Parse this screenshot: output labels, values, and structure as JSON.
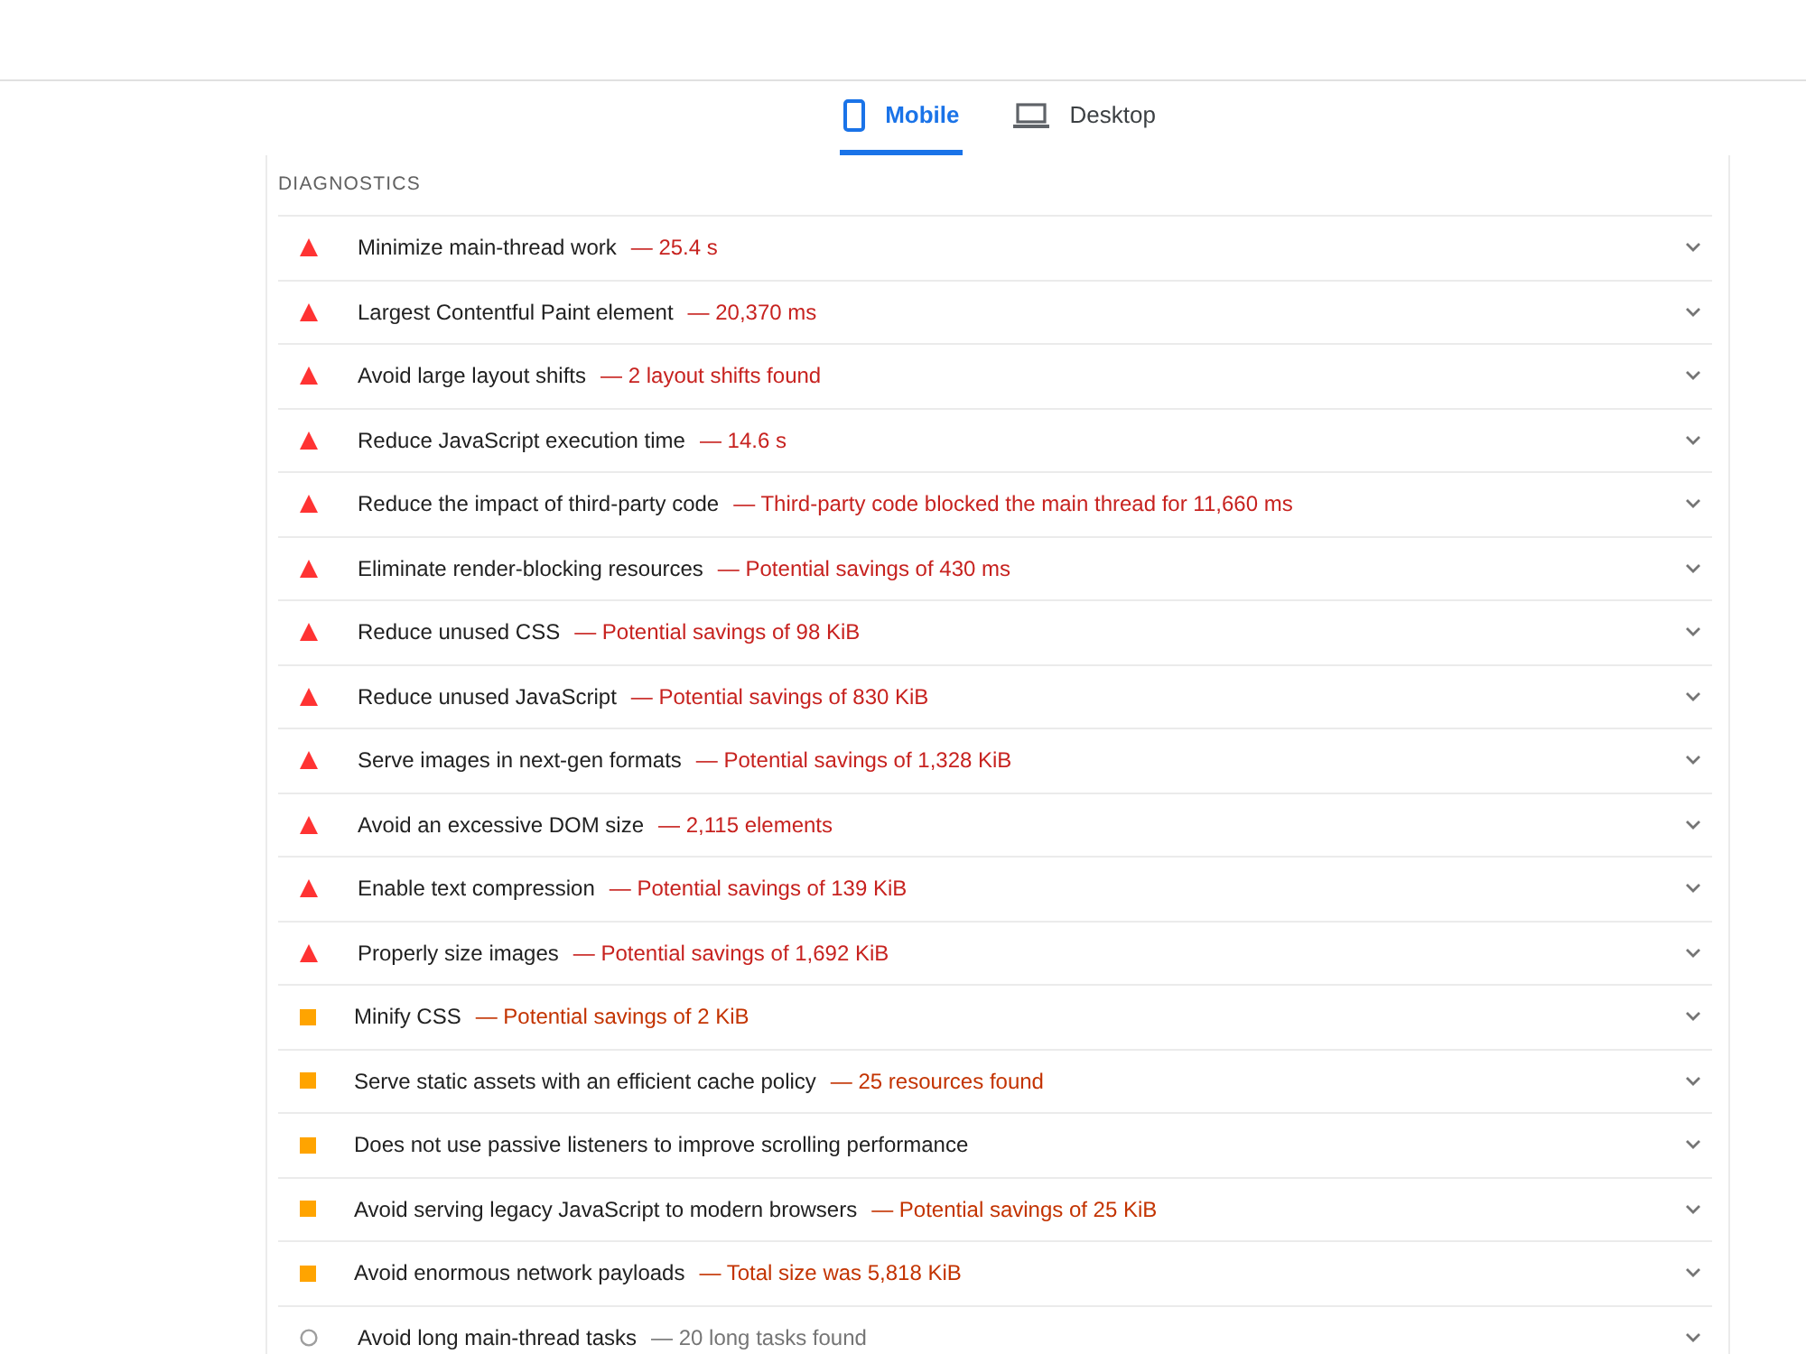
{
  "tabs": [
    {
      "label": "Mobile",
      "kind": "phone",
      "selected": true
    },
    {
      "label": "Desktop",
      "kind": "laptop",
      "selected": false
    }
  ],
  "section": {
    "title": "DIAGNOSTICS"
  },
  "audits": [
    {
      "kind": "fail",
      "title": "Minimize main-thread work",
      "display_value": "— 25.4 s"
    },
    {
      "kind": "fail",
      "title": "Largest Contentful Paint element",
      "display_value": "— 20,370 ms"
    },
    {
      "kind": "fail",
      "title": "Avoid large layout shifts",
      "display_value": "— 2 layout shifts found"
    },
    {
      "kind": "fail",
      "title": "Reduce JavaScript execution time",
      "display_value": "— 14.6 s"
    },
    {
      "kind": "fail",
      "title": "Reduce the impact of third-party code",
      "display_value": "— Third-party code blocked the main thread for 11,660 ms"
    },
    {
      "kind": "fail",
      "title": "Eliminate render-blocking resources",
      "display_value": "— Potential savings of 430 ms"
    },
    {
      "kind": "fail",
      "title": "Reduce unused CSS",
      "display_value": "— Potential savings of 98 KiB"
    },
    {
      "kind": "fail",
      "title": "Reduce unused JavaScript",
      "display_value": "— Potential savings of 830 KiB"
    },
    {
      "kind": "fail",
      "title": "Serve images in next-gen formats",
      "display_value": "— Potential savings of 1,328 KiB"
    },
    {
      "kind": "fail",
      "title": "Avoid an excessive DOM size",
      "display_value": "— 2,115 elements"
    },
    {
      "kind": "fail",
      "title": "Enable text compression",
      "display_value": "— Potential savings of 139 KiB"
    },
    {
      "kind": "fail",
      "title": "Properly size images",
      "display_value": "— Potential savings of 1,692 KiB"
    },
    {
      "kind": "average",
      "title": "Minify CSS",
      "display_value": "— Potential savings of 2 KiB"
    },
    {
      "kind": "average",
      "title": "Serve static assets with an efficient cache policy",
      "display_value": "— 25 resources found"
    },
    {
      "kind": "average",
      "title": "Does not use passive listeners to improve scrolling performance"
    },
    {
      "kind": "average",
      "title": "Avoid serving legacy JavaScript to modern browsers",
      "display_value": "— Potential savings of 25 KiB"
    },
    {
      "kind": "average",
      "title": "Avoid enormous network payloads",
      "display_value": "— Total size was 5,818 KiB"
    },
    {
      "kind": "informative",
      "title": "Avoid long main-thread tasks",
      "display_value": "— 20 long tasks found"
    }
  ]
}
